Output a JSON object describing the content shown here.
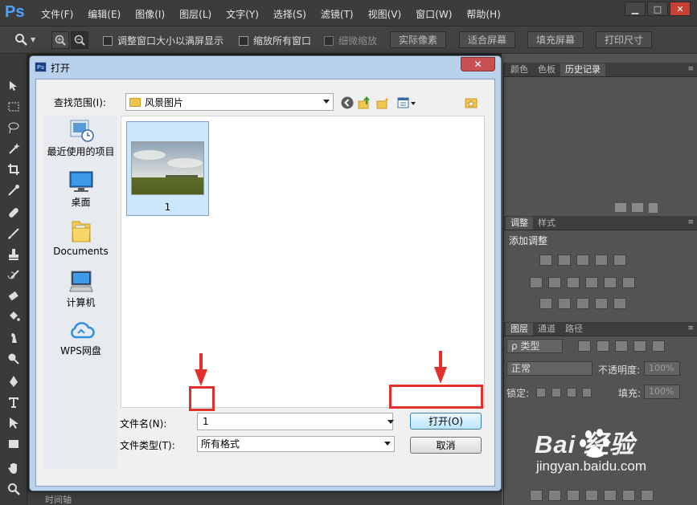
{
  "app": {
    "logo": "Ps",
    "menu": [
      "文件(F)",
      "编辑(E)",
      "图像(I)",
      "图层(L)",
      "文字(Y)",
      "选择(S)",
      "滤镜(T)",
      "视图(V)",
      "窗口(W)",
      "帮助(H)"
    ]
  },
  "options_bar": {
    "resize_windows": "调整窗口大小以满屏显示",
    "zoom_all": "缩放所有窗口",
    "scrubby_zoom": "细微缩放",
    "actual_pixels": "实际像素",
    "fit_screen": "适合屏幕",
    "fill_screen": "填充屏幕",
    "print_size": "打印尺寸"
  },
  "panels": {
    "top_tabs": [
      "颜色",
      "色板",
      "历史记录"
    ],
    "adjust_tabs": [
      "调整",
      "样式"
    ],
    "adjust_title": "添加调整",
    "layer_tabs": [
      "图层",
      "通道",
      "路径"
    ],
    "filter_kind": "ρ 类型",
    "blend_mode": "正常",
    "opacity_label": "不透明度:",
    "opacity_value": "100%",
    "lock_label": "锁定:",
    "fill_label": "填充:",
    "fill_value": "100%"
  },
  "dialog": {
    "title": "打开",
    "lookin_label": "查找范围(I):",
    "lookin_value": "风景图片",
    "places": [
      "最近使用的项目",
      "桌面",
      "Documents",
      "计算机",
      "WPS网盘"
    ],
    "file": {
      "name": "1"
    },
    "filename_label": "文件名(N):",
    "filename_value": "1",
    "filetype_label": "文件类型(T):",
    "filetype_value": "所有格式",
    "open_button": "打开(O)",
    "cancel_button": "取消"
  },
  "status": {
    "timeline": "时间轴"
  },
  "watermark": {
    "brand": "Bai  经验",
    "url": "jingyan.baidu.com"
  },
  "colors": {
    "accent_red": "#e2312b",
    "ps_blue": "#4aa3ff",
    "dialog_frame": "#b9d1ea"
  }
}
